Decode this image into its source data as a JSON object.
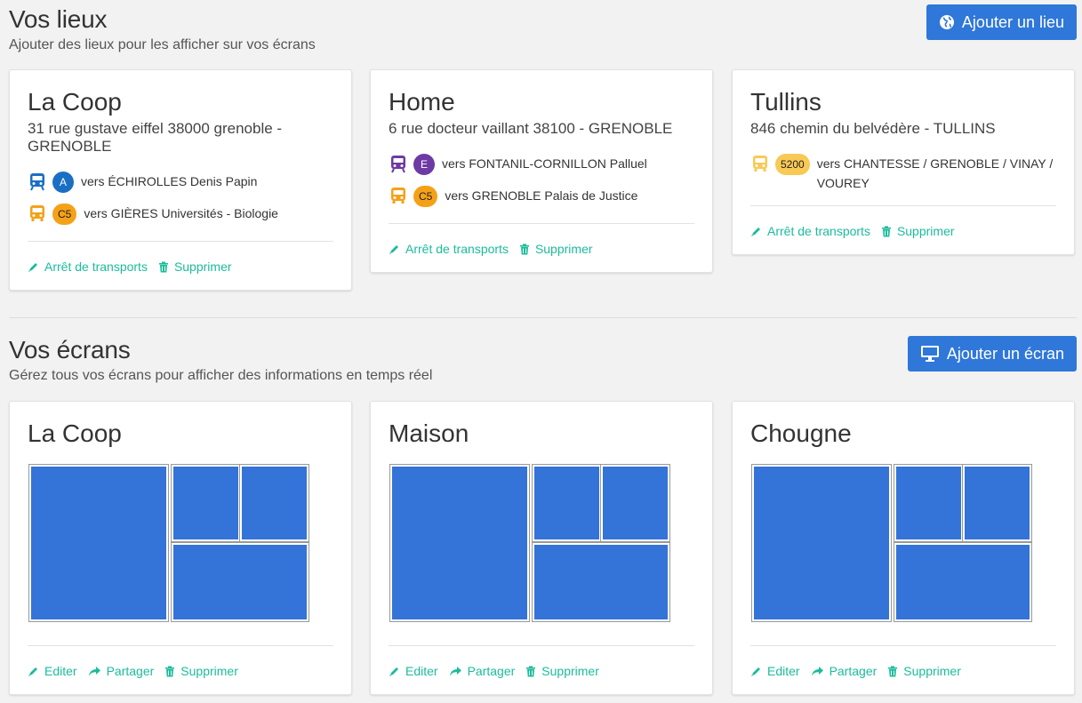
{
  "lieux": {
    "title": "Vos lieux",
    "subtitle": "Ajouter des lieux pour les afficher sur vos écrans",
    "add_button": "Ajouter un lieu",
    "cards": [
      {
        "name": "La Coop",
        "address": "31 rue gustave eiffel 38000 grenoble - GRENOBLE",
        "stops": [
          {
            "mode": "tram-icon",
            "line": "A",
            "badge_bg": "#1a6fc4",
            "badge_fg": "#ffffff",
            "icon_color": "#1a6fc4",
            "direction": "vers ÉCHIROLLES Denis Papin"
          },
          {
            "mode": "bus-icon",
            "line": "C5",
            "badge_bg": "#f5a118",
            "badge_fg": "#222222",
            "icon_color": "#f5a118",
            "direction": "vers GIÈRES Universités - Biologie"
          }
        ],
        "actions": [
          "Arrêt de transports",
          "Supprimer"
        ]
      },
      {
        "name": "Home",
        "address": "6 rue docteur vaillant 38100 - GRENOBLE",
        "stops": [
          {
            "mode": "tram-icon",
            "line": "E",
            "badge_bg": "#6e3aa3",
            "badge_fg": "#ffffff",
            "icon_color": "#6e3aa3",
            "direction": "vers FONTANIL-CORNILLON Palluel"
          },
          {
            "mode": "bus-icon",
            "line": "C5",
            "badge_bg": "#f5a118",
            "badge_fg": "#222222",
            "icon_color": "#f5a118",
            "direction": "vers GRENOBLE Palais de Justice"
          }
        ],
        "actions": [
          "Arrêt de transports",
          "Supprimer"
        ]
      },
      {
        "name": "Tullins",
        "address": "846 chemin du belvédère - TULLINS",
        "stops": [
          {
            "mode": "bus-icon",
            "line": "5200",
            "badge_bg": "#f8c954",
            "badge_fg": "#222222",
            "icon_color": "#f8c954",
            "direction": "vers CHANTESSE / GRENOBLE / VINAY / VOUREY"
          }
        ],
        "actions": [
          "Arrêt de transports",
          "Supprimer"
        ]
      }
    ]
  },
  "ecrans": {
    "title": "Vos écrans",
    "subtitle": "Gérez tous vos écrans pour afficher des informations en temps réel",
    "add_button": "Ajouter un écran",
    "cards": [
      {
        "name": "La Coop",
        "actions": [
          "Editer",
          "Partager",
          "Supprimer"
        ]
      },
      {
        "name": "Maison",
        "actions": [
          "Editer",
          "Partager",
          "Supprimer"
        ]
      },
      {
        "name": "Chougne",
        "actions": [
          "Editer",
          "Partager",
          "Supprimer"
        ]
      }
    ]
  },
  "colors": {
    "accent": "#2f77d9",
    "link": "#1bbc9b",
    "pane": "#3473d8"
  }
}
